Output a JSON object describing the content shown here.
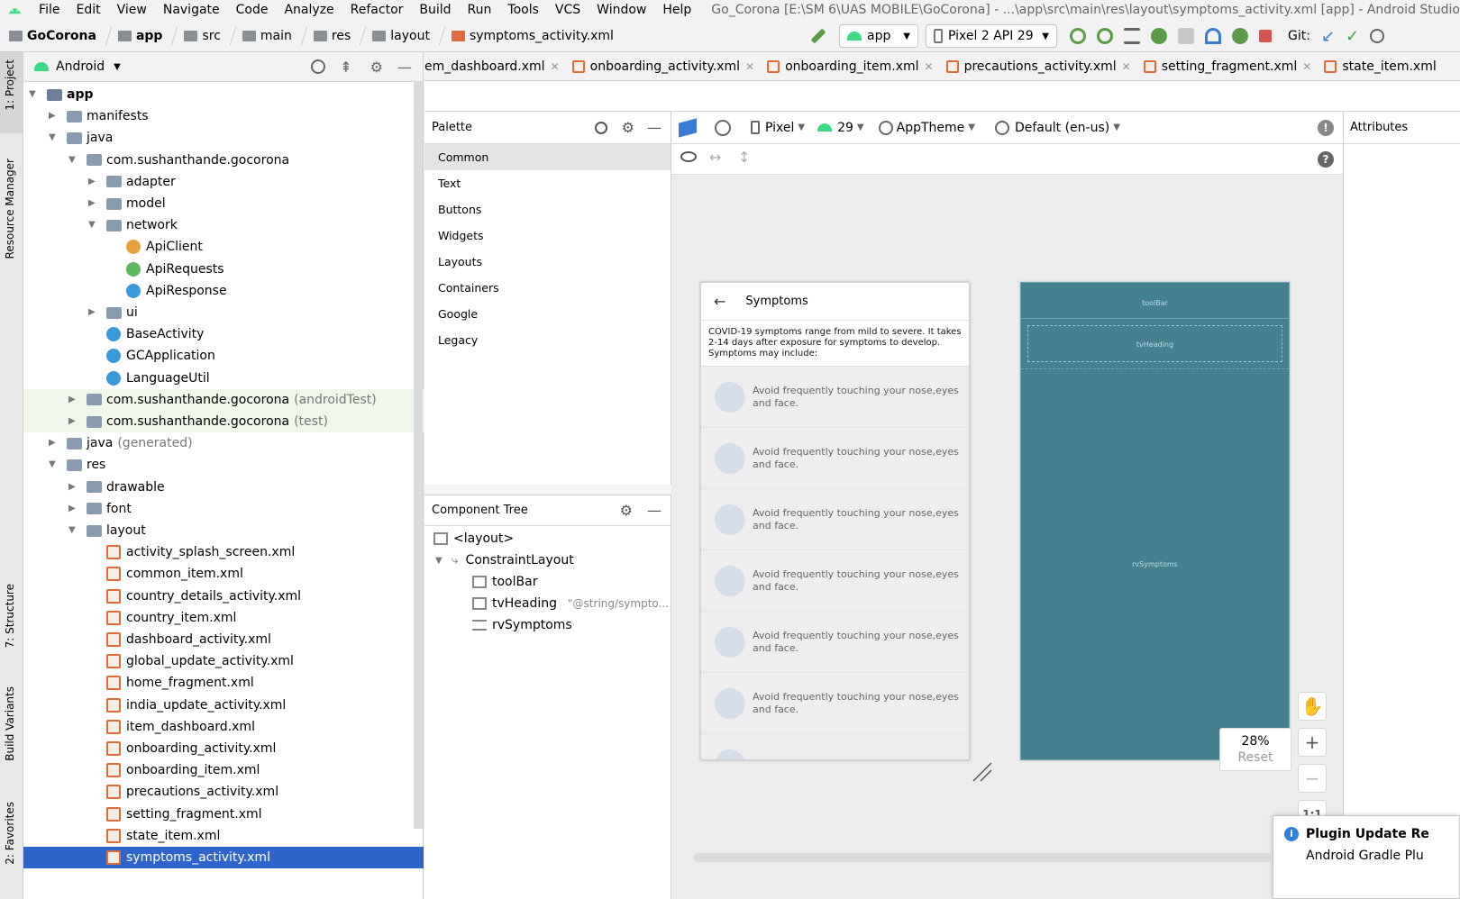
{
  "menu": {
    "items": [
      "File",
      "Edit",
      "View",
      "Navigate",
      "Code",
      "Analyze",
      "Refactor",
      "Build",
      "Run",
      "Tools",
      "VCS",
      "Window",
      "Help"
    ],
    "window_title": "Go_Corona [E:\\SM 6\\UAS MOBILE\\GoCorona] - ...\\app\\src\\main\\res\\layout\\symptoms_activity.xml [app] - Android Studio"
  },
  "breadcrumb": [
    "GoCorona",
    "app",
    "src",
    "main",
    "res",
    "layout",
    "symptoms_activity.xml"
  ],
  "toolbar": {
    "run_config": "app",
    "device": "Pixel 2 API 29",
    "git_label": "Git:"
  },
  "side_stripe": {
    "project": "1: Project",
    "resource_manager": "Resource Manager",
    "structure": "7: Structure",
    "build_variants": "Build Variants",
    "favorites": "2: Favorites"
  },
  "project": {
    "view_mode": "Android",
    "tree": [
      {
        "label": "app",
        "suffix": "",
        "type": "module",
        "depth": 0,
        "expanded": true
      },
      {
        "label": "manifests",
        "suffix": "",
        "type": "folder",
        "depth": 1,
        "expanded": false
      },
      {
        "label": "java",
        "suffix": "",
        "type": "folder",
        "depth": 1,
        "expanded": true
      },
      {
        "label": "com.sushanthande.gocorona",
        "suffix": "",
        "type": "package",
        "depth": 2,
        "expanded": true
      },
      {
        "label": "adapter",
        "suffix": "",
        "type": "package",
        "depth": 3,
        "expanded": false
      },
      {
        "label": "model",
        "suffix": "",
        "type": "package",
        "depth": 3,
        "expanded": false
      },
      {
        "label": "network",
        "suffix": "",
        "type": "package",
        "depth": 3,
        "expanded": true
      },
      {
        "label": "ApiClient",
        "suffix": "",
        "type": "class-orange",
        "depth": 4
      },
      {
        "label": "ApiRequests",
        "suffix": "",
        "type": "class-green",
        "depth": 4
      },
      {
        "label": "ApiResponse",
        "suffix": "",
        "type": "class",
        "depth": 4
      },
      {
        "label": "ui",
        "suffix": "",
        "type": "package",
        "depth": 3,
        "expanded": false
      },
      {
        "label": "BaseActivity",
        "suffix": "",
        "type": "class",
        "depth": 3
      },
      {
        "label": "GCApplication",
        "suffix": "",
        "type": "class",
        "depth": 3
      },
      {
        "label": "LanguageUtil",
        "suffix": "",
        "type": "class",
        "depth": 3
      },
      {
        "label": "com.sushanthande.gocorona",
        "suffix": "(androidTest)",
        "type": "package",
        "depth": 2,
        "expanded": false,
        "green": true
      },
      {
        "label": "com.sushanthande.gocorona",
        "suffix": "(test)",
        "type": "package",
        "depth": 2,
        "expanded": false,
        "green": true
      },
      {
        "label": "java",
        "suffix": "(generated)",
        "type": "folder",
        "depth": 1,
        "expanded": false
      },
      {
        "label": "res",
        "suffix": "",
        "type": "folder",
        "depth": 1,
        "expanded": true
      },
      {
        "label": "drawable",
        "suffix": "",
        "type": "package",
        "depth": 2,
        "expanded": false
      },
      {
        "label": "font",
        "suffix": "",
        "type": "package",
        "depth": 2,
        "expanded": false
      },
      {
        "label": "layout",
        "suffix": "",
        "type": "package",
        "depth": 2,
        "expanded": true
      },
      {
        "label": "activity_splash_screen.xml",
        "suffix": "",
        "type": "xml",
        "depth": 3
      },
      {
        "label": "common_item.xml",
        "suffix": "",
        "type": "xml",
        "depth": 3
      },
      {
        "label": "country_details_activity.xml",
        "suffix": "",
        "type": "xml",
        "depth": 3
      },
      {
        "label": "country_item.xml",
        "suffix": "",
        "type": "xml",
        "depth": 3
      },
      {
        "label": "dashboard_activity.xml",
        "suffix": "",
        "type": "xml",
        "depth": 3
      },
      {
        "label": "global_update_activity.xml",
        "suffix": "",
        "type": "xml",
        "depth": 3
      },
      {
        "label": "home_fragment.xml",
        "suffix": "",
        "type": "xml",
        "depth": 3
      },
      {
        "label": "india_update_activity.xml",
        "suffix": "",
        "type": "xml",
        "depth": 3
      },
      {
        "label": "item_dashboard.xml",
        "suffix": "",
        "type": "xml",
        "depth": 3
      },
      {
        "label": "onboarding_activity.xml",
        "suffix": "",
        "type": "xml",
        "depth": 3
      },
      {
        "label": "onboarding_item.xml",
        "suffix": "",
        "type": "xml",
        "depth": 3
      },
      {
        "label": "precautions_activity.xml",
        "suffix": "",
        "type": "xml",
        "depth": 3
      },
      {
        "label": "setting_fragment.xml",
        "suffix": "",
        "type": "xml",
        "depth": 3
      },
      {
        "label": "state_item.xml",
        "suffix": "",
        "type": "xml",
        "depth": 3
      },
      {
        "label": "symptoms_activity.xml",
        "suffix": "",
        "type": "xml",
        "depth": 3,
        "selected": true
      }
    ]
  },
  "editor_tabs": [
    "em_dashboard.xml",
    "onboarding_activity.xml",
    "onboarding_item.xml",
    "precautions_activity.xml",
    "setting_fragment.xml",
    "state_item.xml"
  ],
  "palette": {
    "title": "Palette",
    "categories": [
      "Common",
      "Text",
      "Buttons",
      "Widgets",
      "Layouts",
      "Containers",
      "Google",
      "Legacy"
    ],
    "selected": "Common"
  },
  "component_tree": {
    "title": "Component Tree",
    "items": [
      {
        "label": "<layout>",
        "extra": "",
        "depth": 0
      },
      {
        "label": "ConstraintLayout",
        "extra": "",
        "depth": 0
      },
      {
        "label": "toolBar",
        "extra": "",
        "depth": 1
      },
      {
        "label": "tvHeading",
        "extra": "\"@string/sympto...",
        "depth": 1
      },
      {
        "label": "rvSymptoms",
        "extra": "",
        "depth": 1
      }
    ]
  },
  "design_toolbar": {
    "device": "Pixel",
    "api": "29",
    "theme": "AppTheme",
    "locale": "Default (en-us)"
  },
  "attributes": {
    "title": "Attributes"
  },
  "preview": {
    "title": "Symptoms",
    "heading": "COVID-19 symptoms range from mild to severe. It takes 2-14 days after exposure for symptoms to develop. Symptoms may include:",
    "items": [
      "Avoid frequently touching your nose,eyes and face.",
      "Avoid frequently touching your nose,eyes and face.",
      "Avoid frequently touching your nose,eyes and face.",
      "Avoid frequently touching your nose,eyes and face.",
      "Avoid frequently touching your nose,eyes and face.",
      "Avoid frequently touching your nose,eyes and face."
    ]
  },
  "blueprint": {
    "toolbar_label": "toolBar",
    "heading_label": "tvHeading",
    "list_label": "rvSymptoms"
  },
  "zoom": {
    "level": "28%",
    "reset": "Reset",
    "one_to_one": "1:1"
  },
  "notification": {
    "title": "Plugin Update Re",
    "body": "Android Gradle Plu"
  },
  "colors": {
    "selection": "#2f65ca",
    "blueprint": "#46808f",
    "android_green": "#3ddc84"
  }
}
